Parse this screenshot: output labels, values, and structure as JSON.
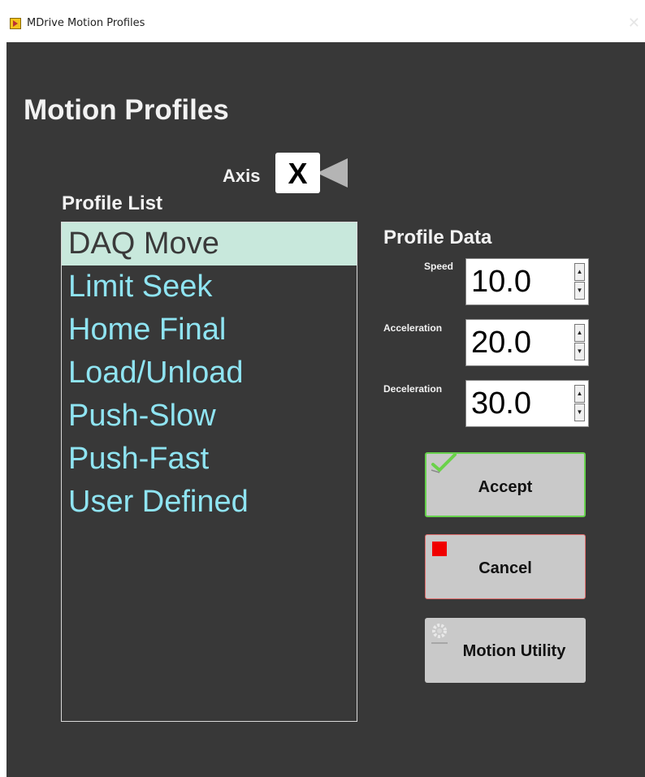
{
  "window": {
    "title": "MDrive Motion Profiles",
    "close_glyph": "✕",
    "app_icon": "labview-run-icon"
  },
  "header": {
    "title": "Motion Profiles"
  },
  "axis": {
    "label": "Axis",
    "value": "X",
    "arrow_icon": "left-triangle-icon"
  },
  "profile_list": {
    "heading": "Profile List",
    "selected_index": 0,
    "items": [
      "DAQ Move",
      "Limit Seek",
      "Home Final",
      "Load/Unload",
      "Push-Slow",
      "Push-Fast",
      "User Defined"
    ]
  },
  "profile_data": {
    "heading": "Profile Data",
    "speed": {
      "label": "Speed",
      "value": "10.0"
    },
    "acceleration": {
      "label": "Acceleration",
      "value": "20.0"
    },
    "deceleration": {
      "label": "Deceleration",
      "value": "30.0"
    },
    "spin_up_glyph": "▲",
    "spin_down_glyph": "▼"
  },
  "buttons": {
    "accept_label": "Accept",
    "cancel_label": "Cancel",
    "utility_label": "Motion Utility"
  },
  "colors": {
    "background": "#383838",
    "list_text": "#8fe4f2",
    "selected_row": "#c8e8dc",
    "accept_border": "#67d14d",
    "cancel_border": "#e06c6c",
    "cancel_icon": "#f00000"
  }
}
